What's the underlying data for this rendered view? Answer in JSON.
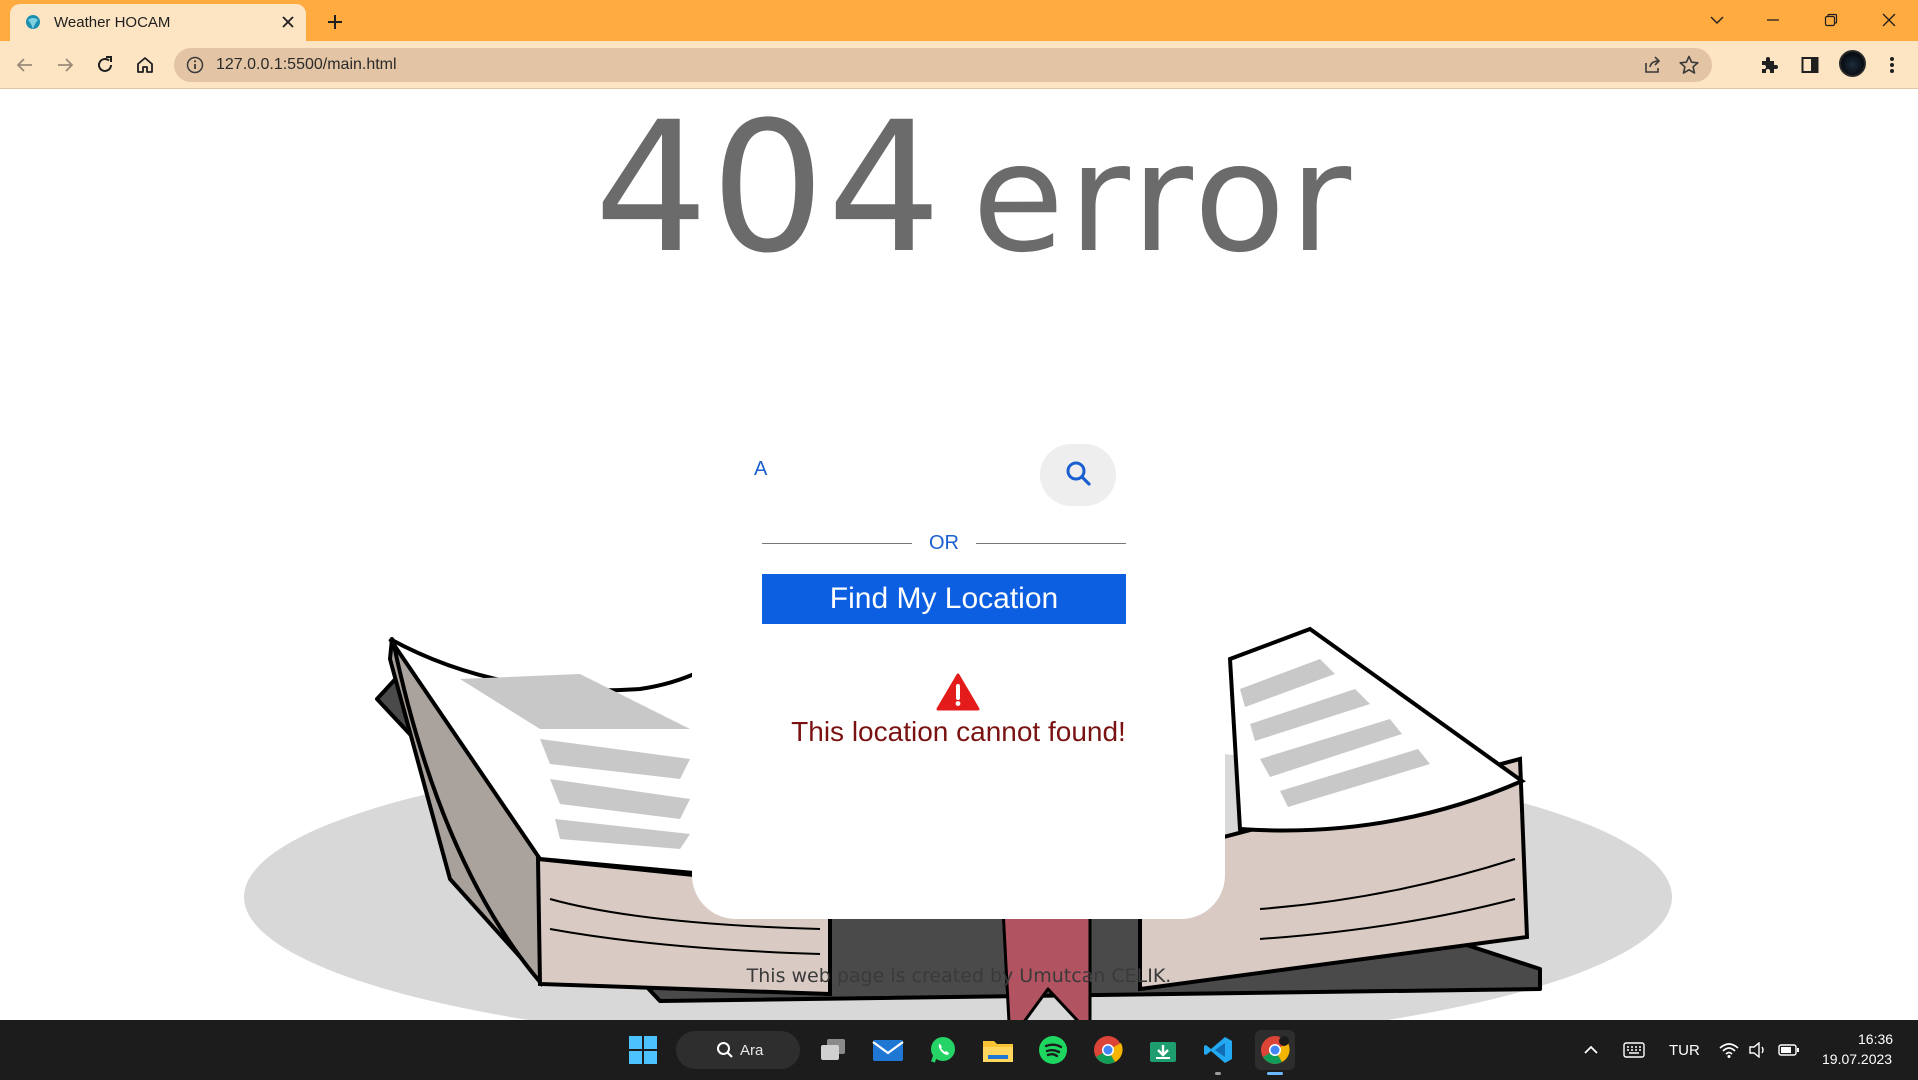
{
  "browser": {
    "tab_title": "Weather HOCAM",
    "url": "127.0.0.1:5500/main.html",
    "icons": [
      "favicon-icon",
      "close-icon",
      "plus-icon",
      "chevron-down-icon",
      "minimize-icon",
      "restore-icon",
      "close-window-icon",
      "back-icon",
      "forward-icon",
      "reload-icon",
      "home-icon",
      "info-icon",
      "share-icon",
      "star-icon",
      "puzzle-icon",
      "sidebar-icon",
      "more-icon"
    ]
  },
  "page": {
    "heading_number": "404",
    "heading_word": "error",
    "search": {
      "value": "A",
      "icon": "search-icon"
    },
    "divider_text": "OR",
    "find_location_label": "Find My Location",
    "error_icon": "warning-icon",
    "error_message": "This location cannot found!",
    "footer": "This web page is created by Umutcan CELIK."
  },
  "taskbar": {
    "search_label": "Ara",
    "apps": [
      "windows-start-icon",
      "task-view-icon",
      "mail-icon",
      "whatsapp-icon",
      "file-explorer-icon",
      "spotify-icon",
      "chrome-icon",
      "download-app-icon",
      "vscode-icon",
      "chrome-active-icon"
    ],
    "language": "TUR",
    "time": "16:36",
    "date": "19.07.2023"
  },
  "colors": {
    "tab_bar": "#ffab40",
    "toolbar": "#fde5c4",
    "omnibox": "#e3c5a5",
    "heading": "#6b6b6b",
    "accent_blue": "#0b5fe0",
    "error_text": "#7a1212",
    "warning_red": "#e31b1b",
    "taskbar": "#1c1c1c"
  }
}
